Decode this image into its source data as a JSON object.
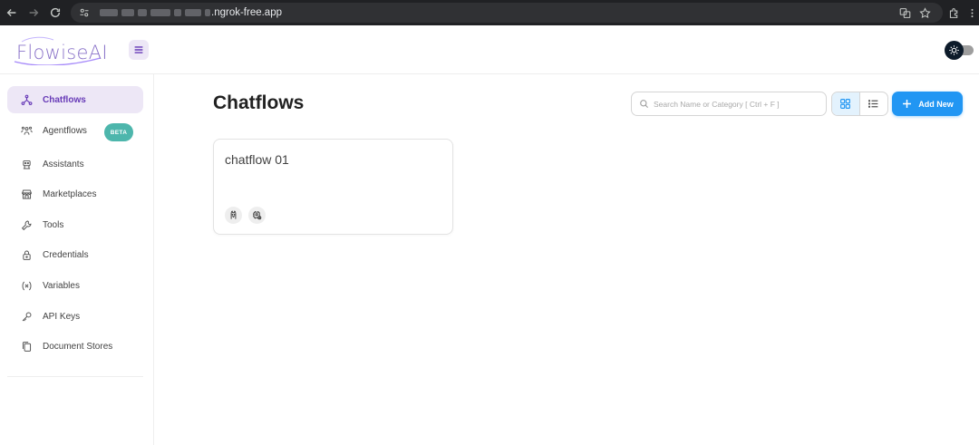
{
  "browser": {
    "url_visible": ".ngrok-free.app"
  },
  "header": {
    "logo_text": "FlowiseAI",
    "brand_color": "#673ab7",
    "logo_color": "#8b74c9"
  },
  "sidebar": {
    "items": [
      {
        "label": "Chatflows",
        "icon": "chatflow-icon",
        "active": true
      },
      {
        "label": "Agentflows",
        "icon": "agents-icon",
        "badge": "BETA"
      },
      {
        "label": "Assistants",
        "icon": "robot-icon"
      },
      {
        "label": "Marketplaces",
        "icon": "store-icon"
      },
      {
        "label": "Tools",
        "icon": "tool-icon"
      },
      {
        "label": "Credentials",
        "icon": "lock-icon"
      },
      {
        "label": "Variables",
        "icon": "variable-icon"
      },
      {
        "label": "API Keys",
        "icon": "key-icon"
      },
      {
        "label": "Document Stores",
        "icon": "files-icon"
      }
    ]
  },
  "main": {
    "title": "Chatflows",
    "search_placeholder": "Search Name or Category [ Ctrl + F ]",
    "add_button_label": "Add New",
    "accent_color": "#2196f3",
    "cards": [
      {
        "title": "chatflow 01",
        "node_icons": [
          "llama-icon",
          "memory-icon"
        ]
      }
    ]
  }
}
